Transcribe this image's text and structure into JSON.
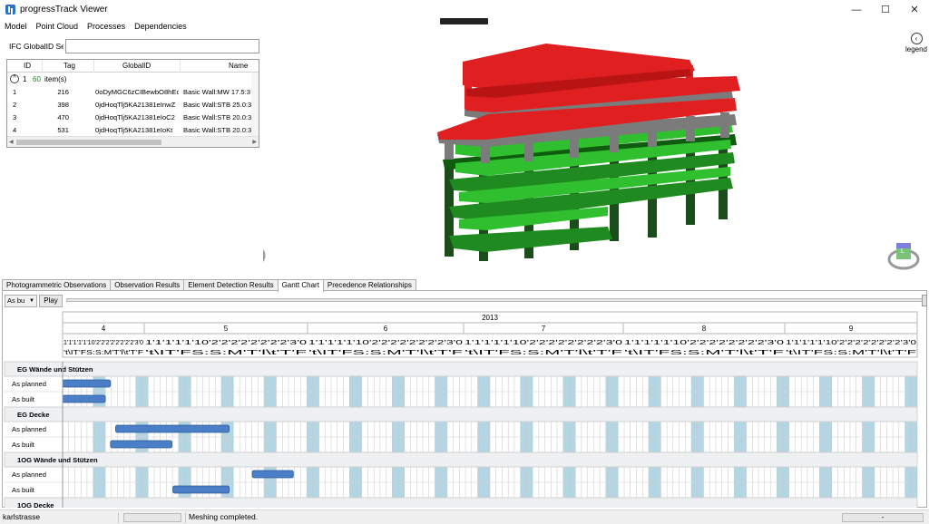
{
  "window": {
    "title": "progressTrack Viewer",
    "minimize": "—",
    "maximize": "☐",
    "close": "✕"
  },
  "menu": [
    "Model",
    "Point Cloud",
    "Processes",
    "Dependencies"
  ],
  "search": {
    "label": "IFC GlobalID Sea:",
    "value": "",
    "placeholder": ""
  },
  "element_table": {
    "columns": [
      "ID",
      "Tag",
      "GlobalID",
      "Name"
    ],
    "group": {
      "toggle": "^",
      "number": "1",
      "count": "60",
      "label": "item(s)"
    },
    "rows": [
      [
        "1",
        "216",
        "0oDyMGC6zCIBewbO8hEc",
        "Basic Wall:MW 17.5:3"
      ],
      [
        "2",
        "398",
        "0jdHoqTlj5KA21381eInwZ",
        "Basic Wall:STB 25.0:3"
      ],
      [
        "3",
        "470",
        "0jdHoqTlj5KA21381eIoC2",
        "Basic Wall:STB 20.0:3"
      ],
      [
        "4",
        "531",
        "0jdHoqTlj5KA21381eIoKt",
        "Basic Wall:STB 20.0:3"
      ]
    ]
  },
  "viewer": {
    "legend_icon": "chevron-left-icon",
    "legend_label": "legend",
    "cube_label_left": "n",
    "cube_label_right": "L"
  },
  "tabs": [
    "Photogrammetric Observations",
    "Observation Results",
    "Element Detection Results",
    "Gantt Chart",
    "Precedence Relationships"
  ],
  "active_tab": "Gantt Chart",
  "gantt_controls": {
    "mode": "As bu",
    "play": "Play",
    "timeline_position": 1.0
  },
  "chart_data": {
    "type": "gantt",
    "year": "2013",
    "months": [
      "4",
      "5",
      "6",
      "7",
      "8",
      "9"
    ],
    "day_digits_row": "1'1'1'1'1'10'2'2'2'2'2'2'2'2'3'0",
    "weekday_row": "'t\\IT'FS:S:M'T'l\\t'T'F",
    "colors": {
      "planned": "#4a7ec6",
      "built": "#4a7ec6",
      "weekend": "#b4d6e4",
      "group_header": "#eef0f2"
    },
    "groups": [
      {
        "name": "EG Wände und Stützen",
        "rows": [
          "As planned",
          "As built"
        ]
      },
      {
        "name": "EG Decke",
        "rows": [
          "As planned",
          "As built"
        ]
      },
      {
        "name": "1OG Wände und Stützen",
        "rows": [
          "As planned",
          "As built"
        ]
      },
      {
        "name": "1OG Decke",
        "rows": []
      }
    ]
  },
  "status": {
    "project": "karlstrasse",
    "message": "Meshing completed.",
    "right": "-"
  }
}
